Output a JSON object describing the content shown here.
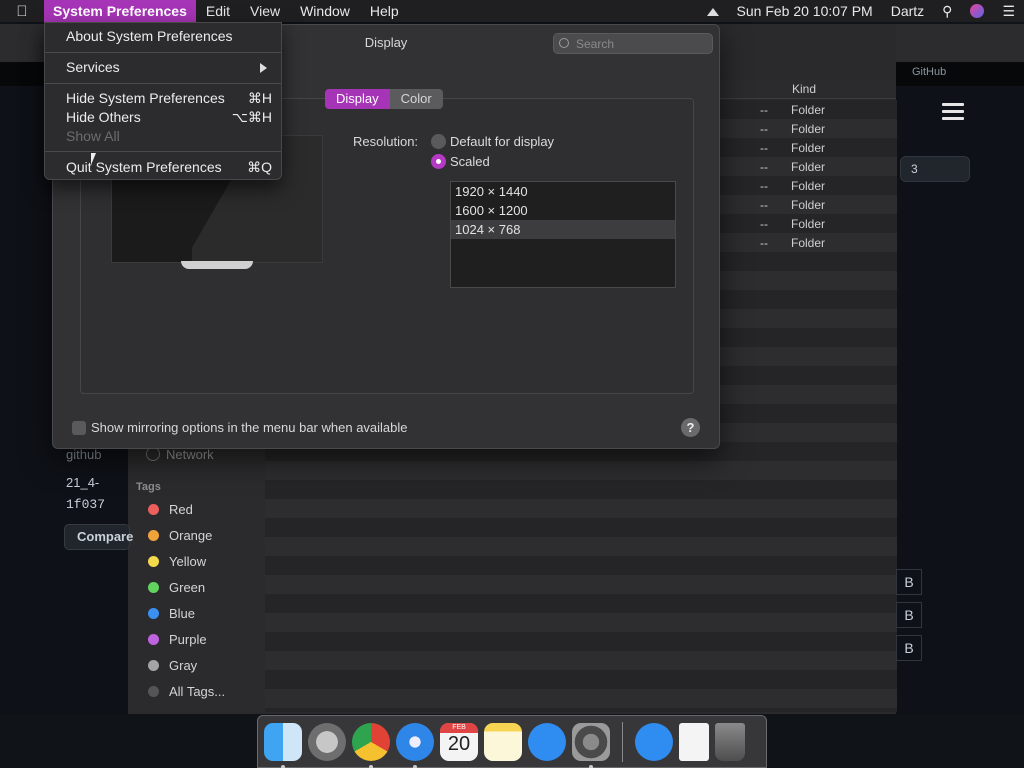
{
  "menubar": {
    "app_menu": "System Preferences",
    "items": [
      "Edit",
      "View",
      "Window",
      "Help"
    ],
    "datetime": "Sun Feb 20  10:07 PM",
    "user": "Dartz"
  },
  "app_menu_dropdown": {
    "about": "About System Preferences",
    "services": "Services",
    "hide": "Hide System Preferences",
    "hide_shortcut": "⌘H",
    "hide_others": "Hide Others",
    "hide_others_shortcut": "⌥⌘H",
    "show_all": "Show All",
    "quit": "Quit System Preferences",
    "quit_shortcut": "⌘Q"
  },
  "prefs_window": {
    "title": "Display",
    "search_placeholder": "Search",
    "tabs": [
      "Display",
      "Color"
    ],
    "selected_tab": "Display",
    "resolution_label": "Resolution:",
    "option_default": "Default for display",
    "option_scaled": "Scaled",
    "selected_option": "Scaled",
    "resolutions": [
      "1920 × 1440",
      "1600 × 1200",
      "1024 × 768"
    ],
    "selected_resolution": "1024 × 768",
    "mirror_checkbox_label": "Show mirroring options in the menu bar when available",
    "mirror_checked": false,
    "help": "?"
  },
  "background": {
    "finder_header_kind": "Kind",
    "finder_rows": [
      {
        "size": "--",
        "kind": "Folder"
      },
      {
        "size": "--",
        "kind": "Folder"
      },
      {
        "size": "--",
        "kind": "Folder"
      },
      {
        "size": "--",
        "kind": "Folder"
      },
      {
        "size": "--",
        "kind": "Folder"
      },
      {
        "size": "--",
        "kind": "Folder"
      },
      {
        "size": "--",
        "kind": "Folder"
      },
      {
        "size": "--",
        "kind": "Folder"
      }
    ],
    "network": "Network",
    "tags_header": "Tags",
    "tags": [
      {
        "name": "Red",
        "color": "#ec5f5d"
      },
      {
        "name": "Orange",
        "color": "#f0a33a"
      },
      {
        "name": "Yellow",
        "color": "#f3d94c"
      },
      {
        "name": "Green",
        "color": "#62d361"
      },
      {
        "name": "Blue",
        "color": "#3a8ff0"
      },
      {
        "name": "Purple",
        "color": "#c063e0"
      },
      {
        "name": "Gray",
        "color": "#a4a4a6"
      },
      {
        "name": "All Tags...",
        "color": "#555557"
      }
    ],
    "github_tab": "GitHub",
    "gh_repo": "github",
    "gh_tag": "21_4-",
    "gh_commit": "1f037",
    "compare_button": "Compare",
    "gh_count": "3",
    "size_b": "B"
  },
  "dock": {
    "calendar_month": "FEB",
    "calendar_day": "20",
    "apps": [
      "finder-icon",
      "launchpad-icon",
      "chrome-icon",
      "safari-icon",
      "calendar-icon",
      "notes-icon",
      "app-store-icon",
      "system-preferences-icon",
      "app-store-download-icon",
      "document-icon",
      "trash-icon"
    ]
  }
}
